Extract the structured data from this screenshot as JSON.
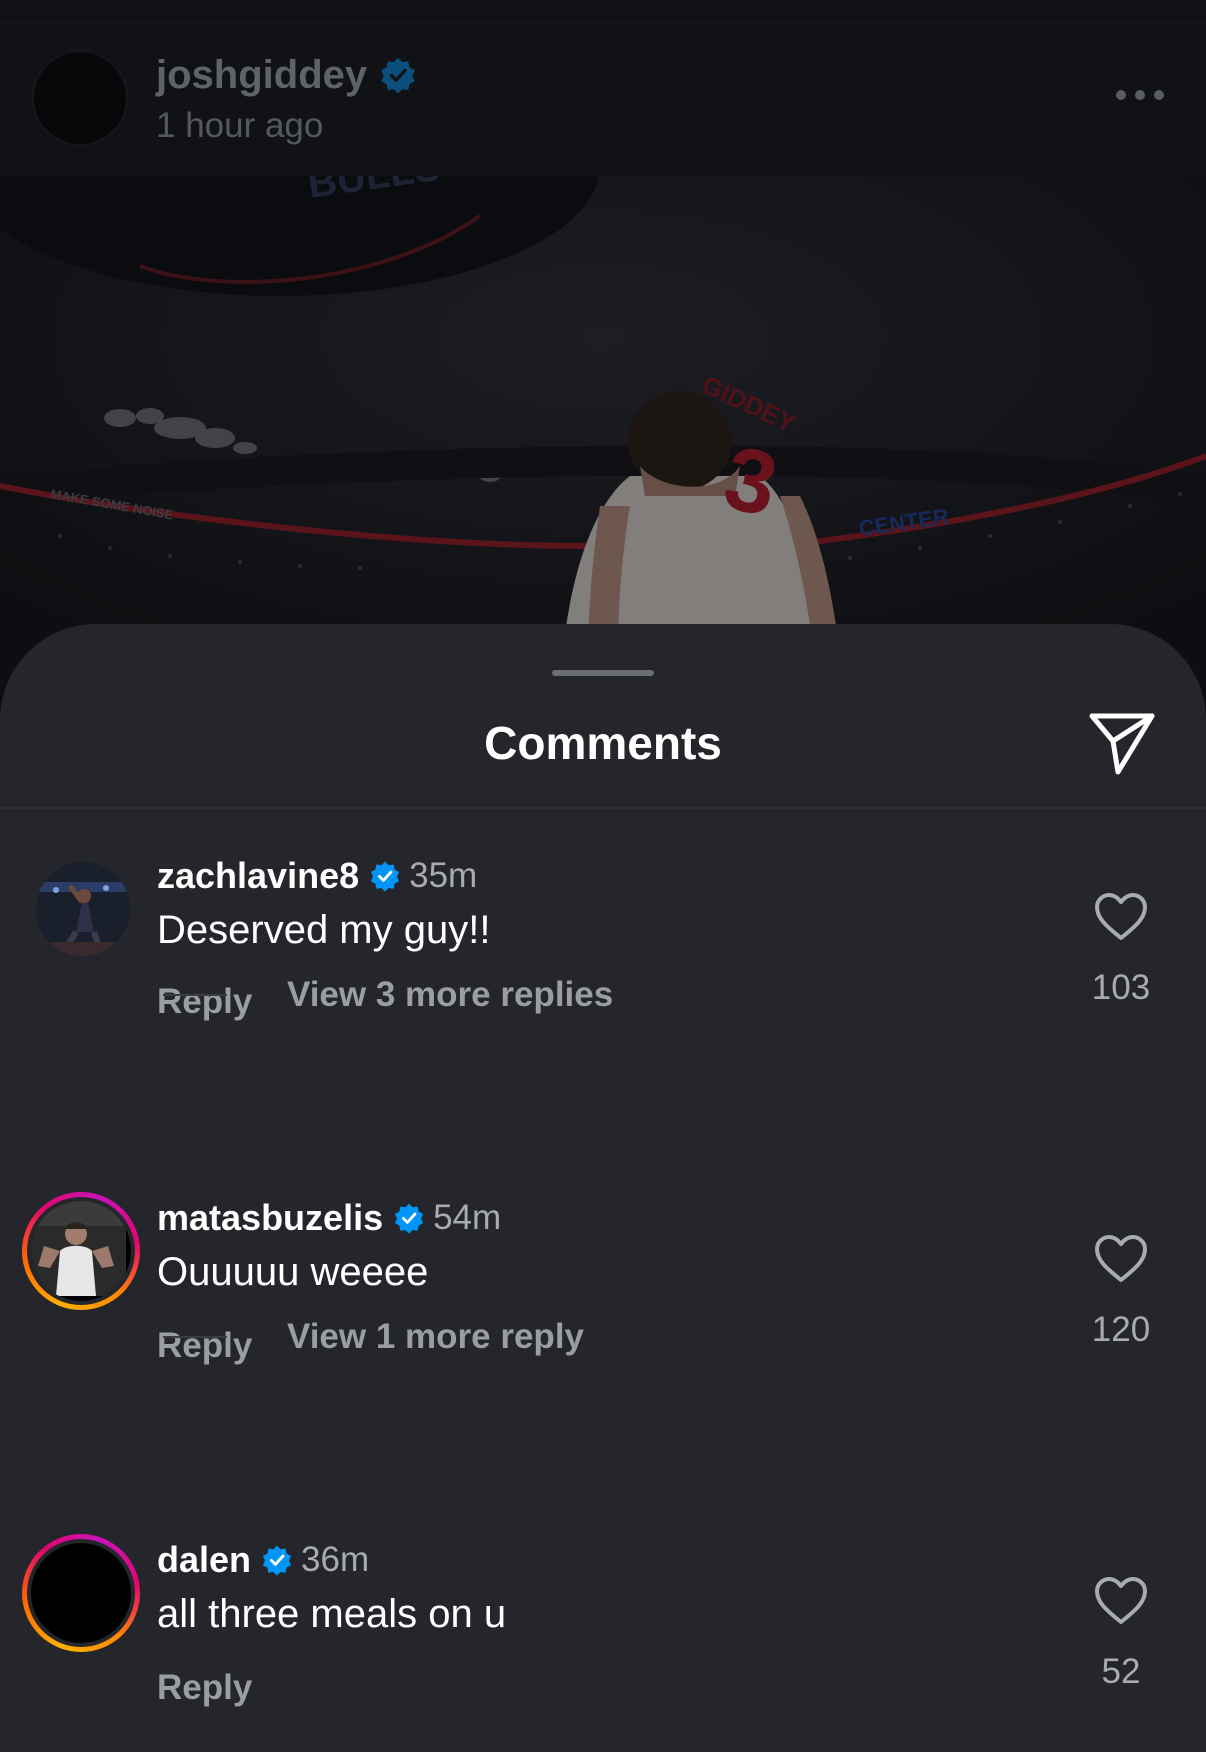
{
  "post": {
    "username": "joshgiddey",
    "time": "1 hour ago",
    "photo_jersey_name": "GIDDEY",
    "photo_jersey_number": "3",
    "photo_arena_text": "CENTER",
    "photo_banner_text": "MAKE SOME NOISE",
    "photo_scoreboard_text": "BULLS"
  },
  "sheet": {
    "title": "Comments"
  },
  "comments": [
    {
      "username": "zachlavine8",
      "time": "35m",
      "text": "Deserved my guy!!",
      "reply_label": "Reply",
      "likes": "103",
      "view_replies": "View 3 more replies"
    },
    {
      "username": "matasbuzelis",
      "time": "54m",
      "text": "Ouuuuu weeee",
      "reply_label": "Reply",
      "likes": "120",
      "view_replies": "View 1 more reply"
    },
    {
      "username": "dalen",
      "time": "36m",
      "text": "all three meals on u",
      "reply_label": "Reply",
      "likes": "52"
    }
  ],
  "colors": {
    "verified": "#0095f6",
    "sheet_bg": "#24262b",
    "story_ring": [
      "#ffb000",
      "#e1066f",
      "#c913b9"
    ]
  },
  "icons": {
    "verified": "verified-badge-icon",
    "more": "more-options-icon",
    "share": "paper-plane-icon",
    "like": "heart-icon"
  }
}
